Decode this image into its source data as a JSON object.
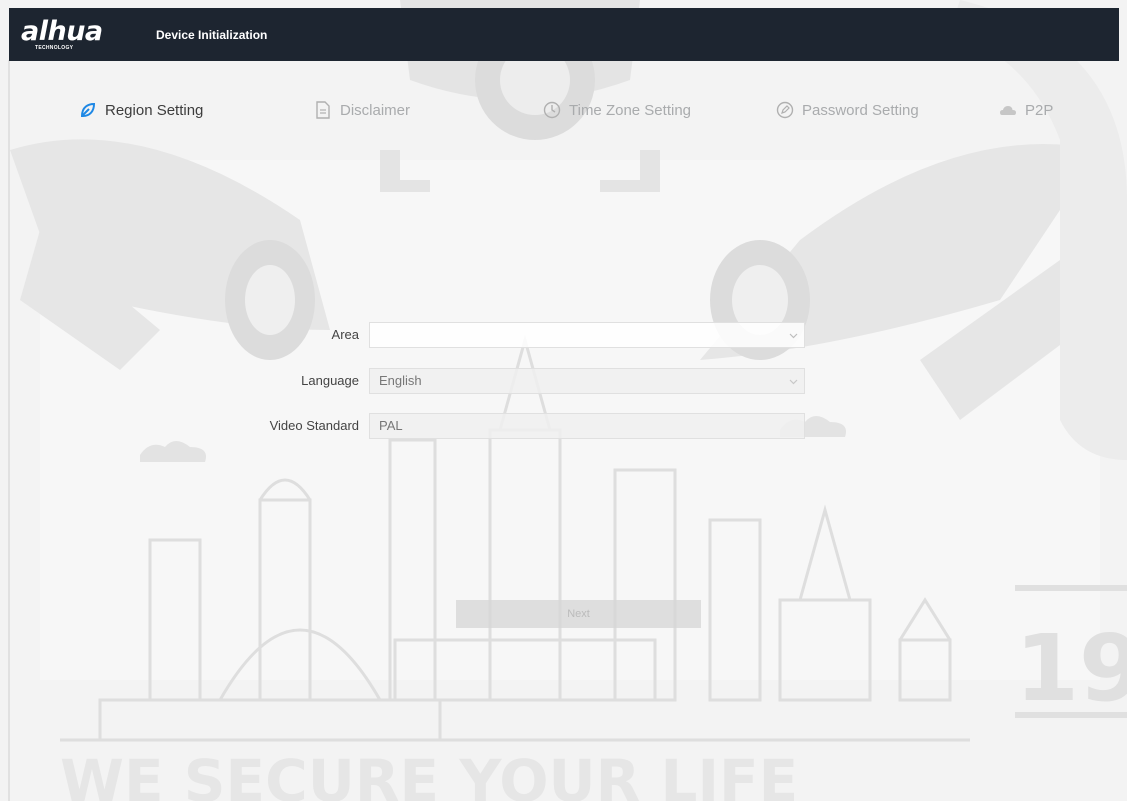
{
  "header": {
    "logo": "alhua",
    "logo_sub": "TECHNOLOGY",
    "title": "Device Initialization"
  },
  "steps": [
    {
      "label": "Region Setting",
      "icon": "leaf-icon",
      "active": true
    },
    {
      "label": "Disclaimer",
      "icon": "document-icon",
      "active": false
    },
    {
      "label": "Time Zone Setting",
      "icon": "clock-icon",
      "active": false
    },
    {
      "label": "Password Setting",
      "icon": "pen-circle-icon",
      "active": false
    },
    {
      "label": "P2P",
      "icon": "cloud-icon",
      "active": false
    }
  ],
  "form": {
    "area": {
      "label": "Area",
      "value": ""
    },
    "language": {
      "label": "Language",
      "value": "English"
    },
    "video_standard": {
      "label": "Video Standard",
      "value": "PAL"
    }
  },
  "buttons": {
    "next": "Next"
  },
  "background": {
    "slogan": "WE SECURE YOUR LIFE",
    "year_mark": "19"
  },
  "colors": {
    "header_bg": "#1d2530",
    "active_step_icon": "#1e88e5",
    "page_bg": "#f3f3f3"
  }
}
